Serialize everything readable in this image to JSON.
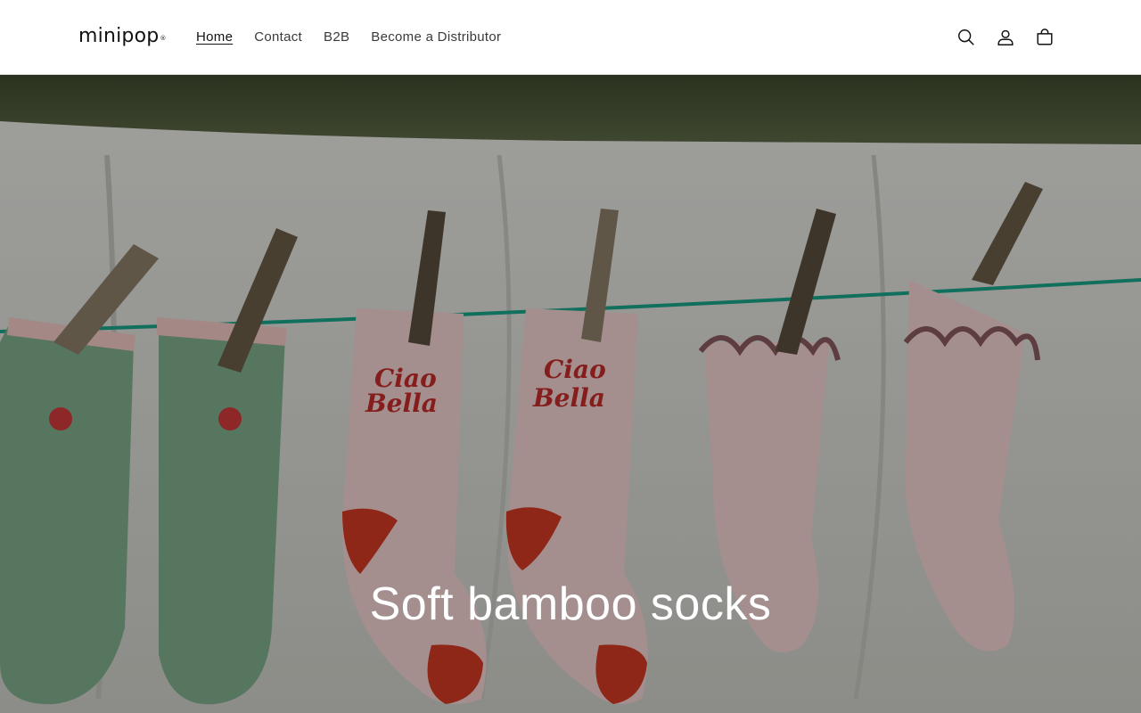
{
  "header": {
    "logo_text": "minipop",
    "logo_mark": "®",
    "nav": [
      {
        "label": "Home",
        "active": true
      },
      {
        "label": "Contact",
        "active": false
      },
      {
        "label": "B2B",
        "active": false
      },
      {
        "label": "Become a Distributor",
        "active": false
      }
    ],
    "icons": [
      "search-icon",
      "account-icon",
      "cart-icon"
    ]
  },
  "hero": {
    "title": "Soft bamboo socks",
    "sock_prints": [
      "Ciao",
      "Bella"
    ],
    "colors": {
      "foliage": "#4d5a3a",
      "sheet": "#dcdcd6",
      "green_sock": "#7fae8c",
      "pink_sock": "#f2d3d2",
      "heel_red": "#d23a22",
      "line_green": "#1aa58a"
    }
  }
}
